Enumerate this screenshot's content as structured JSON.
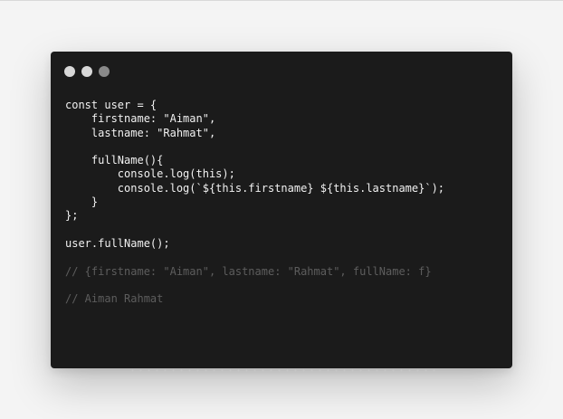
{
  "editor": {
    "controls": [
      {
        "icon": "window-dot-icon",
        "color": "#d8d8d8"
      },
      {
        "icon": "window-dot-icon",
        "color": "#d8d8d8"
      },
      {
        "icon": "window-dot-icon",
        "color": "#8a8a8a"
      }
    ],
    "code_lines": [
      "const user = {",
      "    firstname: \"Aiman\",",
      "    lastname: \"Rahmat\",",
      "",
      "    fullName(){",
      "        console.log(this);",
      "        console.log(`${this.firstname} ${this.lastname}`);",
      "    }",
      "};",
      "",
      "user.fullName();",
      "",
      "// {firstname: \"Aiman\", lastname: \"Rahmat\", fullName: f}",
      "",
      "// Aiman Rahmat"
    ]
  }
}
